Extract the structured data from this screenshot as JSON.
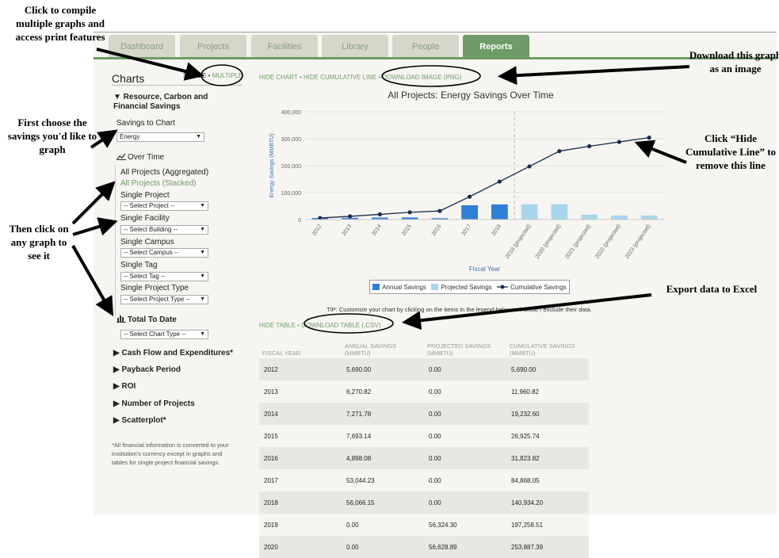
{
  "tabs": [
    "Dashboard",
    "Projects",
    "Facilities",
    "Library",
    "People",
    "Reports"
  ],
  "sidebar": {
    "title": "Charts",
    "view_single": "SINGLE",
    "view_sep": " • ",
    "view_multiple": "MULTIPLE",
    "section_main": "▼ Resource, Carbon and Financial Savings",
    "savings_label": "Savings to Chart",
    "savings_value": "Energy",
    "over_time": "Over Time",
    "all_aggregated": "All Projects (Aggregated)",
    "all_stacked": "All Projects (Stacked)",
    "single_project": "Single Project",
    "select_project": "-- Select Project --",
    "single_facility": "Single Facility",
    "select_building": "-- Select Building --",
    "single_campus": "Single Campus",
    "select_campus": "-- Select Campus --",
    "single_tag": "Single Tag",
    "select_tag": "-- Select Tag --",
    "single_project_type": "Single Project Type",
    "select_project_type": "-- Select Project Type --",
    "total_to_date": "Total To Date",
    "select_chart_type": "-- Select Chart Type --",
    "sections": [
      "▶ Cash Flow and Expenditures*",
      "▶ Payback Period",
      "▶ ROI",
      "▶ Number of Projects",
      "▶ Scatterplot*"
    ],
    "footnote": "*All financial information is converted to your institution's currency except in graphs and tables for single project financial savings."
  },
  "chart_links": {
    "hide_chart": "HIDE CHART",
    "sep": " • ",
    "hide_cumulative": "HIDE CUMULATIVE LINE",
    "download_image": "DOWNLOAD IMAGE (PNG)"
  },
  "chart_data": {
    "type": "bar",
    "title": "All Projects: Energy Savings Over Time",
    "xlabel": "Fiscal Year",
    "ylabel": "Energy Savings (MMBTU)",
    "ylim": [
      0,
      400000
    ],
    "yticks": [
      "0",
      "100,000",
      "200,000",
      "300,000",
      "400,000"
    ],
    "categories": [
      "2012",
      "2013",
      "2014",
      "2015",
      "2016",
      "2017",
      "2018",
      "2019 (projected)",
      "2020 (projected)",
      "2021 (projected)",
      "2022 (projected)",
      "2023 (projected)"
    ],
    "series": [
      {
        "name": "Annual Savings",
        "values": [
          5690,
          6270.82,
          7271.78,
          7693.14,
          4898.08,
          53044.23,
          56066.15,
          0,
          0,
          0,
          0,
          0
        ]
      },
      {
        "name": "Projected Savings",
        "values": [
          0,
          0,
          0,
          0,
          0,
          0,
          0,
          56324.3,
          56628.89,
          18000,
          15000,
          15000
        ]
      },
      {
        "name": "Cumulative Savings",
        "values": [
          5690,
          11960.82,
          19232.6,
          26925.74,
          31823.82,
          84868.05,
          140934.2,
          197258.51,
          253887.39,
          272000,
          288000,
          304000
        ]
      }
    ],
    "colors": {
      "annual": "#2e7fd6",
      "projected": "#a9d5ec",
      "cumulative": "#1a2b4c"
    },
    "legend_position": "bottom"
  },
  "tip": "TIP: Customize your chart by clicking on the items in the legend below to include / exclude their data.",
  "table_links": {
    "hide_table": "HIDE TABLE",
    "sep": " • ",
    "download_table": "DOWNLOAD TABLE (.CSV)"
  },
  "table": {
    "headers": [
      "FISCAL YEAR",
      "ANNUAL SAVINGS (MMBTU)",
      "PROJECTED SAVINGS (MMBTU)",
      "CUMULATIVE SAVINGS (MMBTU)"
    ],
    "rows": [
      [
        "2012",
        "5,690.00",
        "0.00",
        "5,690.00"
      ],
      [
        "2013",
        "6,270.82",
        "0.00",
        "11,960.82"
      ],
      [
        "2014",
        "7,271.78",
        "0.00",
        "19,232.60"
      ],
      [
        "2015",
        "7,693.14",
        "0.00",
        "26,925.74"
      ],
      [
        "2016",
        "4,898.08",
        "0.00",
        "31,823.82"
      ],
      [
        "2017",
        "53,044.23",
        "0.00",
        "84,868.05"
      ],
      [
        "2018",
        "56,066.15",
        "0.00",
        "140,934.20"
      ],
      [
        "2019",
        "0.00",
        "56,324.30",
        "197,258.51"
      ],
      [
        "2020",
        "0.00",
        "56,628.89",
        "253,887.39"
      ]
    ]
  },
  "annotations": {
    "compile": "Click to compile multiple graphs and access print features",
    "choose": "First choose the savings you'd like to graph",
    "then_click": "Then click on any graph to see it",
    "download_graph": "Download this graph as an image",
    "hide_cumulative": "Click “Hide Cumulative Line” to remove this line",
    "export": "Export data to Excel"
  }
}
